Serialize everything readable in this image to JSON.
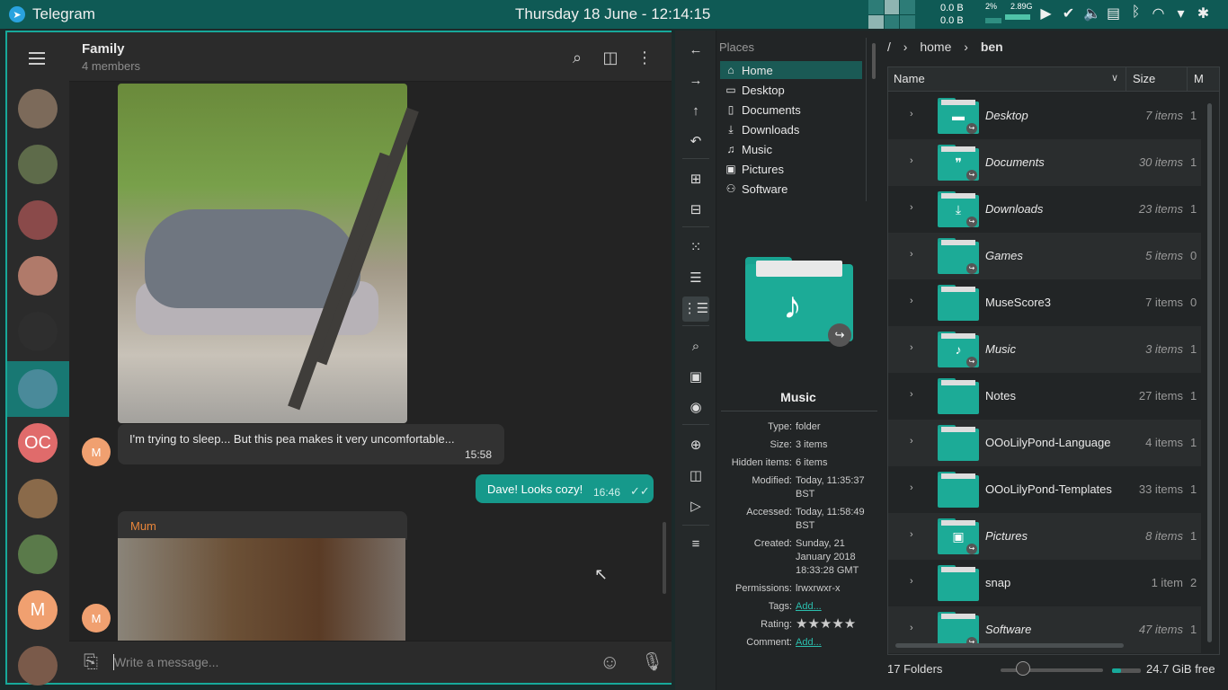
{
  "topbar": {
    "app_name": "Telegram",
    "clock": "Thursday 18 June - 12:14:15",
    "net_up": "0.0 B",
    "net_down": "0.0 B",
    "cpu": "2%",
    "mem": "2.89G"
  },
  "telegram": {
    "chat_title": "Family",
    "chat_subtitle": "4 members",
    "sidebar_chats": [
      {
        "type": "photo",
        "color": "#7c6a5a"
      },
      {
        "type": "photo",
        "color": "#5e6b4a"
      },
      {
        "type": "photo",
        "color": "#8a4a4a"
      },
      {
        "type": "photo",
        "color": "#b07a6a"
      },
      {
        "type": "photo",
        "color": "#2e2e2e"
      },
      {
        "type": "photo",
        "color": "#4a8a9a",
        "selected": true
      },
      {
        "type": "letter",
        "text": "OC",
        "color": "#e06b6b"
      },
      {
        "type": "photo",
        "color": "#8a6a4a"
      },
      {
        "type": "photo",
        "color": "#5a7a4a"
      },
      {
        "type": "letter",
        "text": "M",
        "color": "#f0a070"
      },
      {
        "type": "photo",
        "color": "#7a5a4a"
      }
    ],
    "messages": [
      {
        "text": "I'm trying to sleep... But this pea makes it very uncomfortable...",
        "time": "15:58",
        "avatar": "M"
      },
      {
        "text": "Dave! Looks cozy!",
        "time": "16:46",
        "outgoing": true
      },
      {
        "sender": "Mum",
        "avatar": "M"
      }
    ],
    "composer_placeholder": "Write a message..."
  },
  "dolphin": {
    "places_header": "Places",
    "places": [
      {
        "label": "Home",
        "icon": "⌂",
        "active": true
      },
      {
        "label": "Desktop",
        "icon": "▭"
      },
      {
        "label": "Documents",
        "icon": "▯"
      },
      {
        "label": "Downloads",
        "icon": "⤓"
      },
      {
        "label": "Music",
        "icon": "♫"
      },
      {
        "label": "Pictures",
        "icon": "▣"
      },
      {
        "label": "Software",
        "icon": "⚇"
      }
    ],
    "breadcrumb": [
      "/",
      "home",
      "ben"
    ],
    "info": {
      "name": "Music",
      "props": [
        {
          "k": "Type:",
          "v": "folder"
        },
        {
          "k": "Size:",
          "v": "3 items"
        },
        {
          "k": "Hidden items:",
          "v": "6 items"
        },
        {
          "k": "Modified:",
          "v": "Today, 11:35:37 BST"
        },
        {
          "k": "Accessed:",
          "v": "Today, 11:58:49 BST"
        },
        {
          "k": "Created:",
          "v": "Sunday, 21 January 2018 18:33:28 GMT"
        },
        {
          "k": "Permissions:",
          "v": "lrwxrwxr-x"
        },
        {
          "k": "Tags:",
          "v": "Add...",
          "link": true
        },
        {
          "k": "Rating:",
          "v": "★★★★★",
          "stars": true
        },
        {
          "k": "Comment:",
          "v": "Add...",
          "link": true
        }
      ]
    },
    "columns": {
      "name": "Name",
      "size": "Size",
      "modified": "M"
    },
    "rows": [
      {
        "name": "Desktop",
        "size": "7 items",
        "m": "1",
        "italic": true,
        "glyph": "▬",
        "link": true
      },
      {
        "name": "Documents",
        "size": "30 items",
        "m": "1",
        "italic": true,
        "glyph": "❞",
        "link": true
      },
      {
        "name": "Downloads",
        "size": "23 items",
        "m": "1",
        "italic": true,
        "glyph": "⤓",
        "link": true
      },
      {
        "name": "Games",
        "size": "5 items",
        "m": "0",
        "italic": true,
        "glyph": "",
        "link": true
      },
      {
        "name": "MuseScore3",
        "size": "7 items",
        "m": "0",
        "italic": false,
        "glyph": "",
        "link": false
      },
      {
        "name": "Music",
        "size": "3 items",
        "m": "1",
        "italic": true,
        "glyph": "♪",
        "link": true
      },
      {
        "name": "Notes",
        "size": "27 items",
        "m": "1",
        "italic": false,
        "glyph": "",
        "link": false
      },
      {
        "name": "OOoLilyPond-Language",
        "size": "4 items",
        "m": "1",
        "italic": false,
        "glyph": "",
        "link": false
      },
      {
        "name": "OOoLilyPond-Templates",
        "size": "33 items",
        "m": "1",
        "italic": false,
        "glyph": "",
        "link": false
      },
      {
        "name": "Pictures",
        "size": "8 items",
        "m": "1",
        "italic": true,
        "glyph": "▣",
        "link": true
      },
      {
        "name": "snap",
        "size": "1 item",
        "m": "2",
        "italic": false,
        "glyph": "",
        "link": false
      },
      {
        "name": "Software",
        "size": "47 items",
        "m": "1",
        "italic": true,
        "glyph": "",
        "link": true
      }
    ],
    "status": {
      "count": "17 Folders",
      "free": "24.7 GiB free"
    }
  }
}
